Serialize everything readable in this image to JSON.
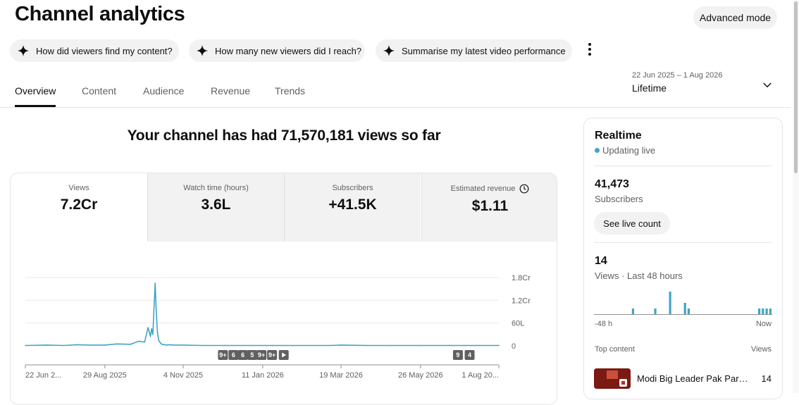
{
  "page": {
    "title": "Channel analytics",
    "advanced_mode": "Advanced mode"
  },
  "suggestions": [
    {
      "label": "How did viewers find my content?",
      "icon": "sparkle-icon"
    },
    {
      "label": "How many new viewers did I reach?",
      "icon": "sparkle-icon"
    },
    {
      "label": "Summarise my latest video performance",
      "icon": "sparkle-icon"
    }
  ],
  "tabs": [
    {
      "label": "Overview",
      "active": true
    },
    {
      "label": "Content"
    },
    {
      "label": "Audience"
    },
    {
      "label": "Revenue"
    },
    {
      "label": "Trends"
    }
  ],
  "date_picker": {
    "range": "22 Jun 2025 – 1 Aug 2026",
    "period": "Lifetime"
  },
  "headline": "Your channel has had 71,570,181 views so far",
  "metrics": [
    {
      "label": "Views",
      "value": "7.2Cr",
      "active": true
    },
    {
      "label": "Watch time (hours)",
      "value": "3.6L"
    },
    {
      "label": "Subscribers",
      "value": "+41.5K"
    },
    {
      "label": "Estimated revenue",
      "value": "$1.11",
      "icon": "clock-icon"
    }
  ],
  "chart_data": {
    "type": "line",
    "title": "",
    "xlabel": "",
    "ylabel": "",
    "ylim": [
      0,
      1.8
    ],
    "y_unit": "Cr",
    "y_ticks": [
      "1.8Cr",
      "1.2Cr",
      "60L",
      "0"
    ],
    "y_tick_values": [
      1.8,
      1.2,
      0.6,
      0
    ],
    "x_ticks": [
      "22 Jun 2...",
      "29 Aug 2025",
      "4 Nov 2025",
      "11 Jan 2026",
      "19 Mar 2026",
      "26 May 2026",
      "1 Aug 20..."
    ],
    "x_tick_dates": [
      "2025-06-22",
      "2025-08-29",
      "2025-11-04",
      "2026-01-11",
      "2026-03-19",
      "2026-05-26",
      "2026-08-01"
    ],
    "x_range": [
      "2025-06-22",
      "2026-08-01"
    ],
    "color": "#3ea6c4",
    "series": [
      {
        "x": [
          "2025-06-22",
          "2025-07-10",
          "2025-07-25",
          "2025-08-05",
          "2025-08-15",
          "2025-08-29",
          "2025-09-08",
          "2025-09-20",
          "2025-09-27",
          "2025-10-02",
          "2025-10-05",
          "2025-10-07",
          "2025-10-08",
          "2025-10-09",
          "2025-10-10",
          "2025-10-11",
          "2025-10-12",
          "2025-10-13",
          "2025-10-14",
          "2025-10-15",
          "2025-10-16",
          "2025-10-17",
          "2025-10-19",
          "2025-10-21",
          "2025-10-24",
          "2025-10-27",
          "2025-11-04",
          "2025-11-20",
          "2025-12-10",
          "2026-01-01",
          "2026-01-20",
          "2026-02-15",
          "2026-03-10",
          "2026-03-19",
          "2026-04-10",
          "2026-05-01",
          "2026-05-26",
          "2026-06-20",
          "2026-07-15",
          "2026-08-01"
        ],
        "values": [
          0.01,
          0.02,
          0.01,
          0.03,
          0.02,
          0.02,
          0.05,
          0.04,
          0.12,
          0.1,
          0.48,
          0.25,
          0.45,
          0.3,
          0.95,
          1.65,
          0.9,
          0.35,
          0.15,
          0.1,
          0.06,
          0.04,
          0.03,
          0.02,
          0.03,
          0.02,
          0.02,
          0.01,
          0.01,
          0.01,
          0.01,
          0.01,
          0.01,
          0.02,
          0.01,
          0.01,
          0.01,
          0.01,
          0.01,
          0.01
        ]
      }
    ],
    "markers": [
      {
        "label": "9+",
        "date": "2025-12-08"
      },
      {
        "label": "6",
        "date": "2025-12-17"
      },
      {
        "label": "6",
        "date": "2025-12-25"
      },
      {
        "label": "5",
        "date": "2026-01-02"
      },
      {
        "label": "9+",
        "date": "2026-01-10"
      },
      {
        "label": "9+",
        "date": "2026-01-19"
      },
      {
        "label": "▶",
        "date": "2026-01-29"
      },
      {
        "label": "9",
        "date": "2026-06-27"
      },
      {
        "label": "4",
        "date": "2026-07-07"
      }
    ]
  },
  "realtime": {
    "title": "Realtime",
    "status": "Updating live",
    "subscribers_value": "41,473",
    "subscribers_label": "Subscribers",
    "see_live_label": "See live count",
    "views_value": "14",
    "views_label": "Views · Last 48 hours",
    "axis_start": "-48 h",
    "axis_end": "Now",
    "hourly_views": [
      0,
      0,
      0,
      0,
      0,
      0,
      0,
      0,
      0,
      0,
      1,
      0,
      0,
      0,
      0,
      0,
      1,
      0,
      0,
      0,
      4,
      0,
      0,
      0,
      2,
      1,
      0,
      0,
      0,
      0,
      0,
      0,
      0,
      0,
      0,
      0,
      0,
      0,
      0,
      0,
      0,
      0,
      0,
      0,
      1,
      1,
      1,
      1
    ],
    "top_content_label": "Top content",
    "views_col_label": "Views",
    "top_content": [
      {
        "title": "Modi Big Leader Pak Parli...",
        "views": "14"
      }
    ]
  }
}
